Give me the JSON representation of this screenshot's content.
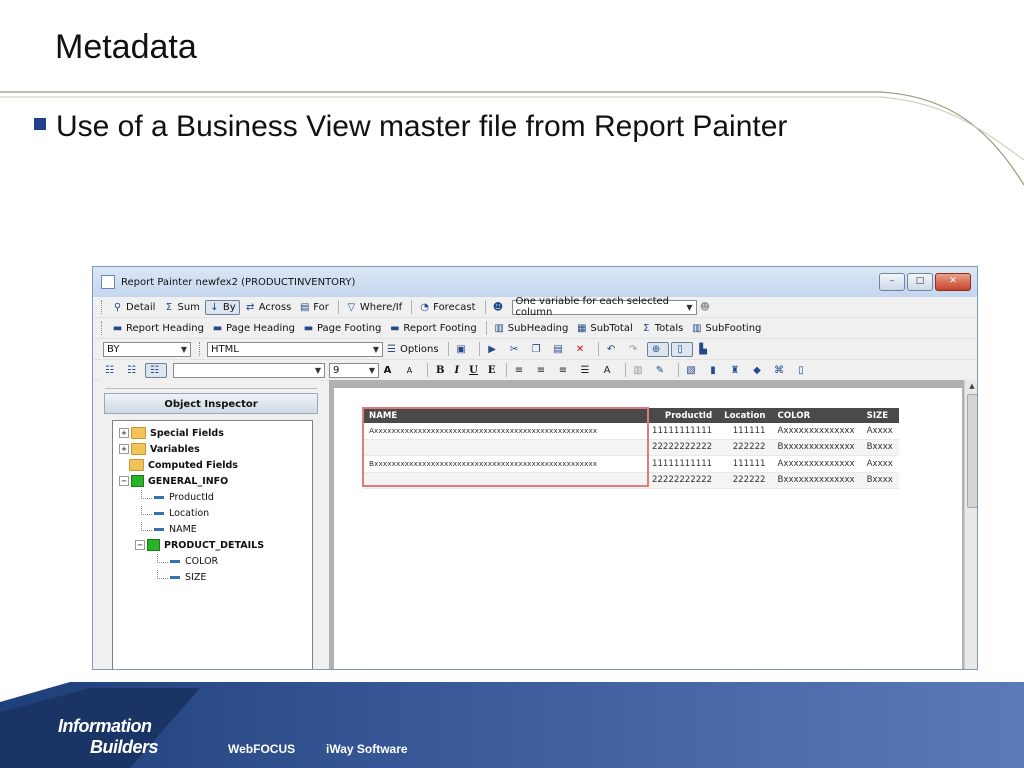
{
  "slide": {
    "title": "Metadata",
    "bullet": "Use of a Business View master file from Report Painter"
  },
  "window": {
    "title": "Report Painter newfex2 (PRODUCTINVENTORY)",
    "controls": {
      "minimize": "–",
      "maximize": "□",
      "close": "✕"
    }
  },
  "toolbar1": {
    "detail": "Detail",
    "sum": "Sum",
    "by": "By",
    "across": "Across",
    "for": "For",
    "whereif": "Where/If",
    "forecast": "Forecast",
    "variable_select": "One variable for each selected column"
  },
  "toolbar2": {
    "report_heading": "Report Heading",
    "page_heading": "Page Heading",
    "page_footing": "Page Footing",
    "report_footing": "Report Footing",
    "subheading": "SubHeading",
    "subtotal": "SubTotal",
    "totals": "Totals",
    "subfooting": "SubFooting"
  },
  "toolbar3": {
    "by_select": "BY",
    "format_select": "HTML",
    "options": "Options"
  },
  "toolbar4": {
    "font_select": "",
    "size_select": "9",
    "bold": "B",
    "italic": "I",
    "underline": "U",
    "other": "E"
  },
  "inspector": {
    "label": "Object Inspector",
    "tree": {
      "special_fields": "Special Fields",
      "variables": "Variables",
      "computed_fields": "Computed Fields",
      "general_info": "GENERAL_INFO",
      "productid": "ProductId",
      "location": "Location",
      "name": "NAME",
      "product_details": "PRODUCT_DETAILS",
      "color": "COLOR",
      "size": "SIZE"
    }
  },
  "report": {
    "headers": {
      "name": "NAME",
      "productid": "ProductId",
      "location": "Location",
      "color": "COLOR",
      "size": "SIZE"
    },
    "rows": [
      {
        "name": "Axxxxxxxxxxxxxxxxxxxxxxxxxxxxxxxxxxxxxxxxxxxxxxxxxxx",
        "productid": "11111111111",
        "location": "111111",
        "color": "Axxxxxxxxxxxxxx",
        "size": "Axxxx"
      },
      {
        "name": "",
        "productid": "22222222222",
        "location": "222222",
        "color": "Bxxxxxxxxxxxxxx",
        "size": "Bxxxx"
      },
      {
        "name": "Bxxxxxxxxxxxxxxxxxxxxxxxxxxxxxxxxxxxxxxxxxxxxxxxxxxx",
        "productid": "11111111111",
        "location": "111111",
        "color": "Axxxxxxxxxxxxxx",
        "size": "Axxxx"
      },
      {
        "name": "",
        "productid": "22222222222",
        "location": "222222",
        "color": "Bxxxxxxxxxxxxxx",
        "size": "Bxxxx"
      }
    ]
  },
  "footer": {
    "logo_line1": "Information",
    "logo_line2": "Builders",
    "webfocus": "WebFOCUS",
    "iway": "iWay Software"
  }
}
